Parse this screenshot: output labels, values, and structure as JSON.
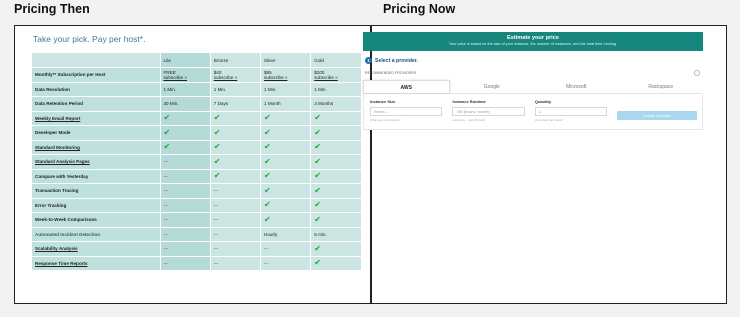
{
  "headings": {
    "then": "Pricing Then",
    "now": "Pricing Now"
  },
  "then": {
    "tagline": "Take your pick. Pay per host*.",
    "plans": [
      "Lite",
      "Bronze",
      "Silver",
      "Gold"
    ],
    "rows": [
      {
        "feature": "Monthly** Subscription per Host",
        "style": "plain",
        "cells": [
          [
            "FREE",
            "subscribe »"
          ],
          [
            "$40",
            "subscribe »"
          ],
          [
            "$85",
            "subscribe »"
          ],
          [
            "$200",
            "subscribe »"
          ]
        ]
      },
      {
        "feature": "Data Resolution",
        "style": "plain",
        "cells": [
          "1 Min.",
          "1 Min.",
          "1 Min.",
          "1 Min."
        ]
      },
      {
        "feature": "Data Retention Period",
        "style": "plain",
        "cells": [
          "30 Min.",
          "7 Days",
          "1 Month",
          "3 Months"
        ]
      },
      {
        "feature": "Weekly Email Report",
        "style": "link",
        "cells": [
          "✔",
          "✔",
          "✔",
          "✔"
        ]
      },
      {
        "feature": "Developer Mode",
        "style": "plain",
        "cells": [
          "✔",
          "✔",
          "✔",
          "✔"
        ]
      },
      {
        "feature": "Standard Monitoring",
        "style": "link",
        "cells": [
          "✔",
          "✔",
          "✔",
          "✔"
        ]
      },
      {
        "feature": "Standard Analysis Pages",
        "style": "link",
        "cells": [
          "—",
          "✔",
          "✔",
          "✔"
        ]
      },
      {
        "feature": "Compare with Yesterday",
        "style": "plain",
        "cells": [
          "—",
          "✔",
          "✔",
          "✔"
        ]
      },
      {
        "feature": "Transaction Tracing",
        "style": "plain",
        "cells": [
          "—",
          "—",
          "✔",
          "✔"
        ]
      },
      {
        "feature": "Error Tracking",
        "style": "plain",
        "cells": [
          "—",
          "—",
          "✔",
          "✔"
        ]
      },
      {
        "feature": "Week-to-Week Comparisons",
        "style": "plain",
        "cells": [
          "—",
          "—",
          "✔",
          "✔"
        ]
      },
      {
        "feature": "Automated Incident Detection",
        "style": "subdued",
        "cells": [
          "—",
          "—",
          "Hourly",
          "5 min."
        ]
      },
      {
        "feature": "Scalability Analysis",
        "style": "link",
        "cells": [
          "—",
          "—",
          "—",
          "✔"
        ]
      },
      {
        "feature": "Response Time Reports",
        "style": "link",
        "cells": [
          "—",
          "—",
          "—",
          "✔"
        ]
      }
    ]
  },
  "now": {
    "banner_title": "Estimate your price",
    "banner_sub": "Your price is based on the size of your instance, the number of instances, and the total time running.",
    "step_num": "1",
    "step_label": "Select a provider.",
    "reco": "RECOMMENDED PROVIDERS",
    "tabs": [
      "AWS",
      "Google",
      "Microsoft",
      "Rackspace"
    ],
    "active_tab": "AWS",
    "fields": [
      {
        "label": "Instance Size",
        "placeholder": "Select...",
        "hint": "What type of instance?"
      },
      {
        "label": "Instance Runtime",
        "placeholder": "750 (hours / month)",
        "hint": "How long... (avg 8 hrs/d)"
      },
      {
        "label": "Quantity",
        "placeholder": "1",
        "hint": "How many are there?"
      }
    ],
    "create_button": "Create instance"
  },
  "colors": {
    "accent": "#17867c",
    "check": "#22a832",
    "table_bg": "#bfe1de"
  }
}
